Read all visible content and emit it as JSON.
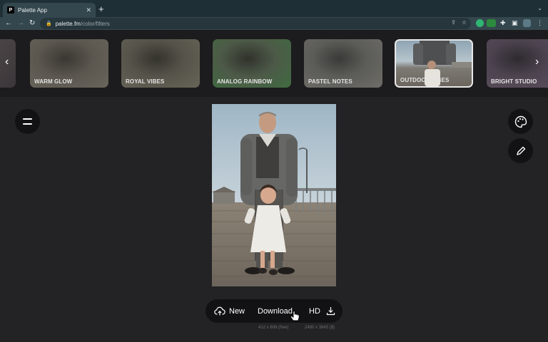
{
  "browser": {
    "tab_title": "Palette App",
    "favicon_letter": "P",
    "new_tab": "+",
    "tab_close": "✕",
    "url_host": "palette.fm",
    "url_path": "/color/filters"
  },
  "filters": [
    {
      "label": "WARM GLOW"
    },
    {
      "label": "ROYAL VIBES"
    },
    {
      "label": "ANALOG RAINBOW"
    },
    {
      "label": "PASTEL NOTES"
    },
    {
      "label": "OUTDOOR VIBES",
      "selected": true
    },
    {
      "label": "BRIGHT STUDIO"
    }
  ],
  "actions": {
    "new_label": "New",
    "download_label": "Download",
    "hd_label": "HD",
    "free_size": "412 x 606 (free)",
    "hd_size": "2480 x 3645 ($)"
  },
  "colors": {
    "page_bg": "#232224",
    "strip_bg": "#1c1b1d",
    "button_bg": "#121214",
    "chrome_bg": "#35474e"
  },
  "icons": {
    "menu": "hamburger-icon",
    "palette": "palette-icon",
    "edit": "pencil-icon",
    "upload": "cloud-upload-icon",
    "download": "download-icon"
  }
}
